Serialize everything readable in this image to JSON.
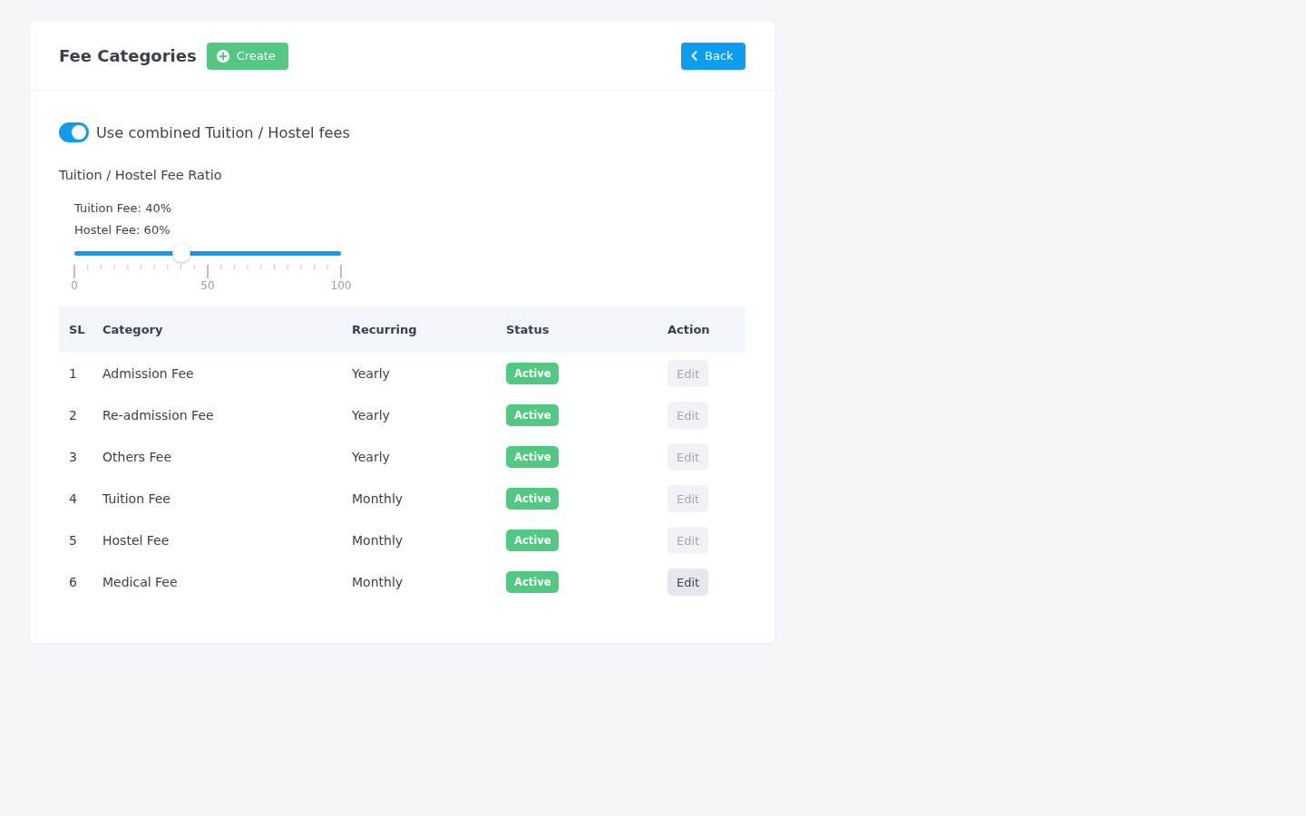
{
  "header": {
    "title": "Fee Categories",
    "create_button": "Create",
    "back_button": "Back"
  },
  "combined_toggle": {
    "label": "Use combined Tuition / Hostel fees",
    "on": true
  },
  "ratio": {
    "title": "Tuition / Hostel Fee Ratio",
    "readings": [
      "Tuition Fee: 40%",
      "Hostel Fee: 60%"
    ],
    "slider": {
      "level": 0.4,
      "tick_labels": [
        "0",
        "50",
        "100"
      ]
    }
  },
  "table": {
    "columns": [
      "SL",
      "Category",
      "Recurring",
      "Status",
      "Action"
    ],
    "rows": [
      {
        "sl": "1",
        "category": "Admission Fee",
        "recurring": "Yearly",
        "status": "Active",
        "action": "Edit",
        "disabled": true
      },
      {
        "sl": "2",
        "category": "Re-admission Fee",
        "recurring": "Yearly",
        "status": "Active",
        "action": "Edit",
        "disabled": true
      },
      {
        "sl": "3",
        "category": "Others Fee",
        "recurring": "Yearly",
        "status": "Active",
        "action": "Edit",
        "disabled": true
      },
      {
        "sl": "4",
        "category": "Tuition Fee",
        "recurring": "Monthly",
        "status": "Active",
        "action": "Edit",
        "disabled": true
      },
      {
        "sl": "5",
        "category": "Hostel Fee",
        "recurring": "Monthly",
        "status": "Active",
        "action": "Edit",
        "disabled": true
      },
      {
        "sl": "6",
        "category": "Medical Fee",
        "recurring": "Monthly",
        "status": "Active",
        "action": "Edit",
        "disabled": false
      }
    ]
  }
}
